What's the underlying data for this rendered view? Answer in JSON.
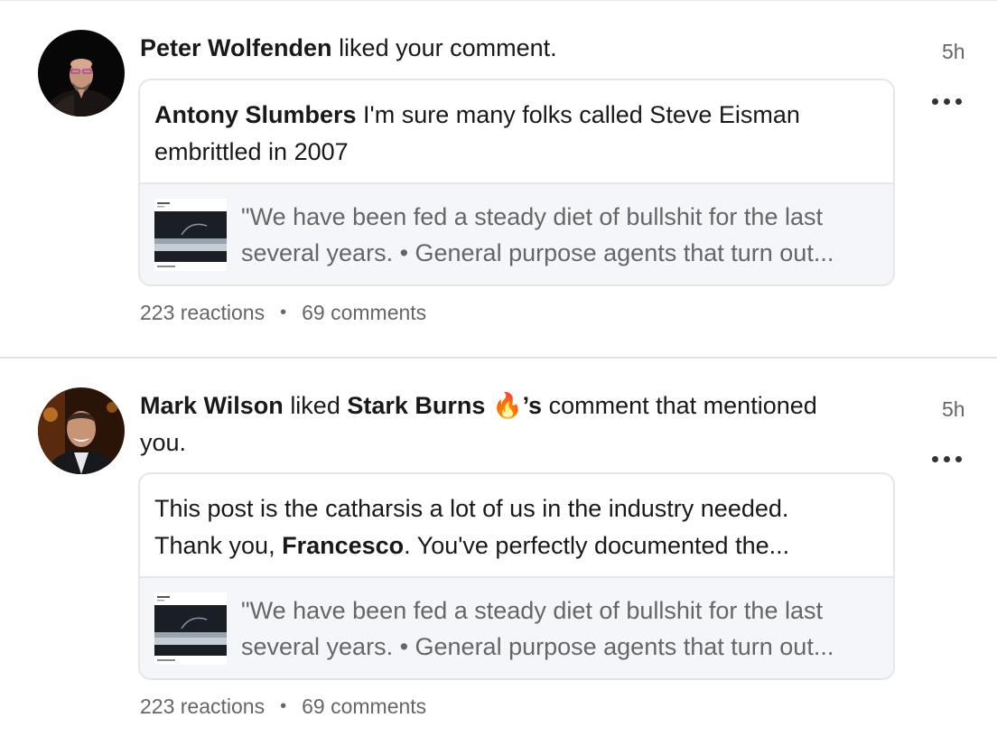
{
  "notifications": [
    {
      "actor": "Peter Wolfenden",
      "action": "liked your comment.",
      "time": "5h",
      "comment": {
        "author": "Antony Slumbers",
        "text_line1": "I'm sure many folks called Steve Eisman",
        "text_line2": "embrittled in 2007"
      },
      "post": {
        "line1": "\"We have been fed a steady diet of bullshit for the last",
        "line2": "several years. • General purpose agents that turn out..."
      },
      "reactions": "223 reactions",
      "comments": "69 comments"
    },
    {
      "actor": "Mark Wilson",
      "action_mid": "liked",
      "mentioned_user": "Stark Burns",
      "emoji": "🔥",
      "possessive": "’s",
      "action_rest_line1": "comment that mentioned",
      "action_rest_line2": "you.",
      "time": "5h",
      "comment": {
        "text_line1": "This post is the catharsis a lot of us in the industry needed.",
        "line2_prefix": "Thank you,",
        "mention": "Francesco",
        "line2_suffix": ". You've perfectly documented the..."
      },
      "post": {
        "line1": "\"We have been fed a steady diet of bullshit for the last",
        "line2": "several years. • General purpose agents that turn out..."
      },
      "reactions": "223 reactions",
      "comments": "69 comments"
    }
  ],
  "separator": "•",
  "icons": [
    "more-options-icon",
    "fire-emoji"
  ],
  "colors": {
    "text": "#191919",
    "muted": "#666666",
    "card_border": "#e6e6e6",
    "post_bg": "#f4f6f9"
  }
}
